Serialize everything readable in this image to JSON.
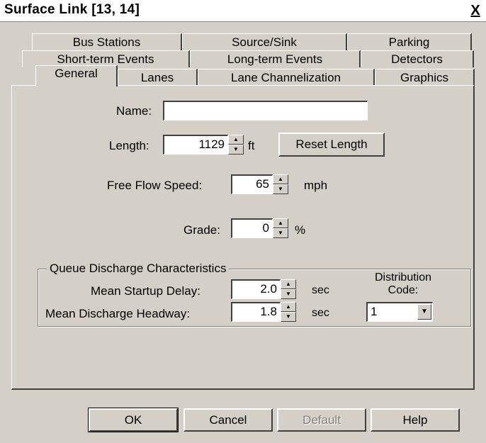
{
  "window": {
    "title": "Surface Link [13, 14]",
    "close_label": "X"
  },
  "tabs": {
    "row1": [
      "Bus Stations",
      "Source/Sink",
      "Parking"
    ],
    "row2": [
      "Short-term Events",
      "Long-term Events",
      "Detectors"
    ],
    "row3": [
      "General",
      "Lanes",
      "Lane Channelization",
      "Graphics"
    ],
    "active": "General"
  },
  "general": {
    "name_label": "Name:",
    "name_value": "",
    "length_label": "Length:",
    "length_value": "1129",
    "length_unit": "ft",
    "reset_length_label": "Reset Length",
    "free_flow_label": "Free Flow Speed:",
    "free_flow_value": "65",
    "free_flow_unit": "mph",
    "grade_label": "Grade:",
    "grade_value": "0",
    "grade_unit": "%"
  },
  "queue": {
    "group_label": "Queue Discharge Characteristics",
    "startup_label": "Mean Startup Delay:",
    "startup_value": "2.0",
    "startup_unit": "sec",
    "headway_label": "Mean Discharge Headway:",
    "headway_value": "1.8",
    "headway_unit": "sec",
    "distribution_label_1": "Distribution",
    "distribution_label_2": "Code:",
    "distribution_value": "1"
  },
  "buttons": {
    "ok": "OK",
    "cancel": "Cancel",
    "default": "Default",
    "help": "Help"
  }
}
